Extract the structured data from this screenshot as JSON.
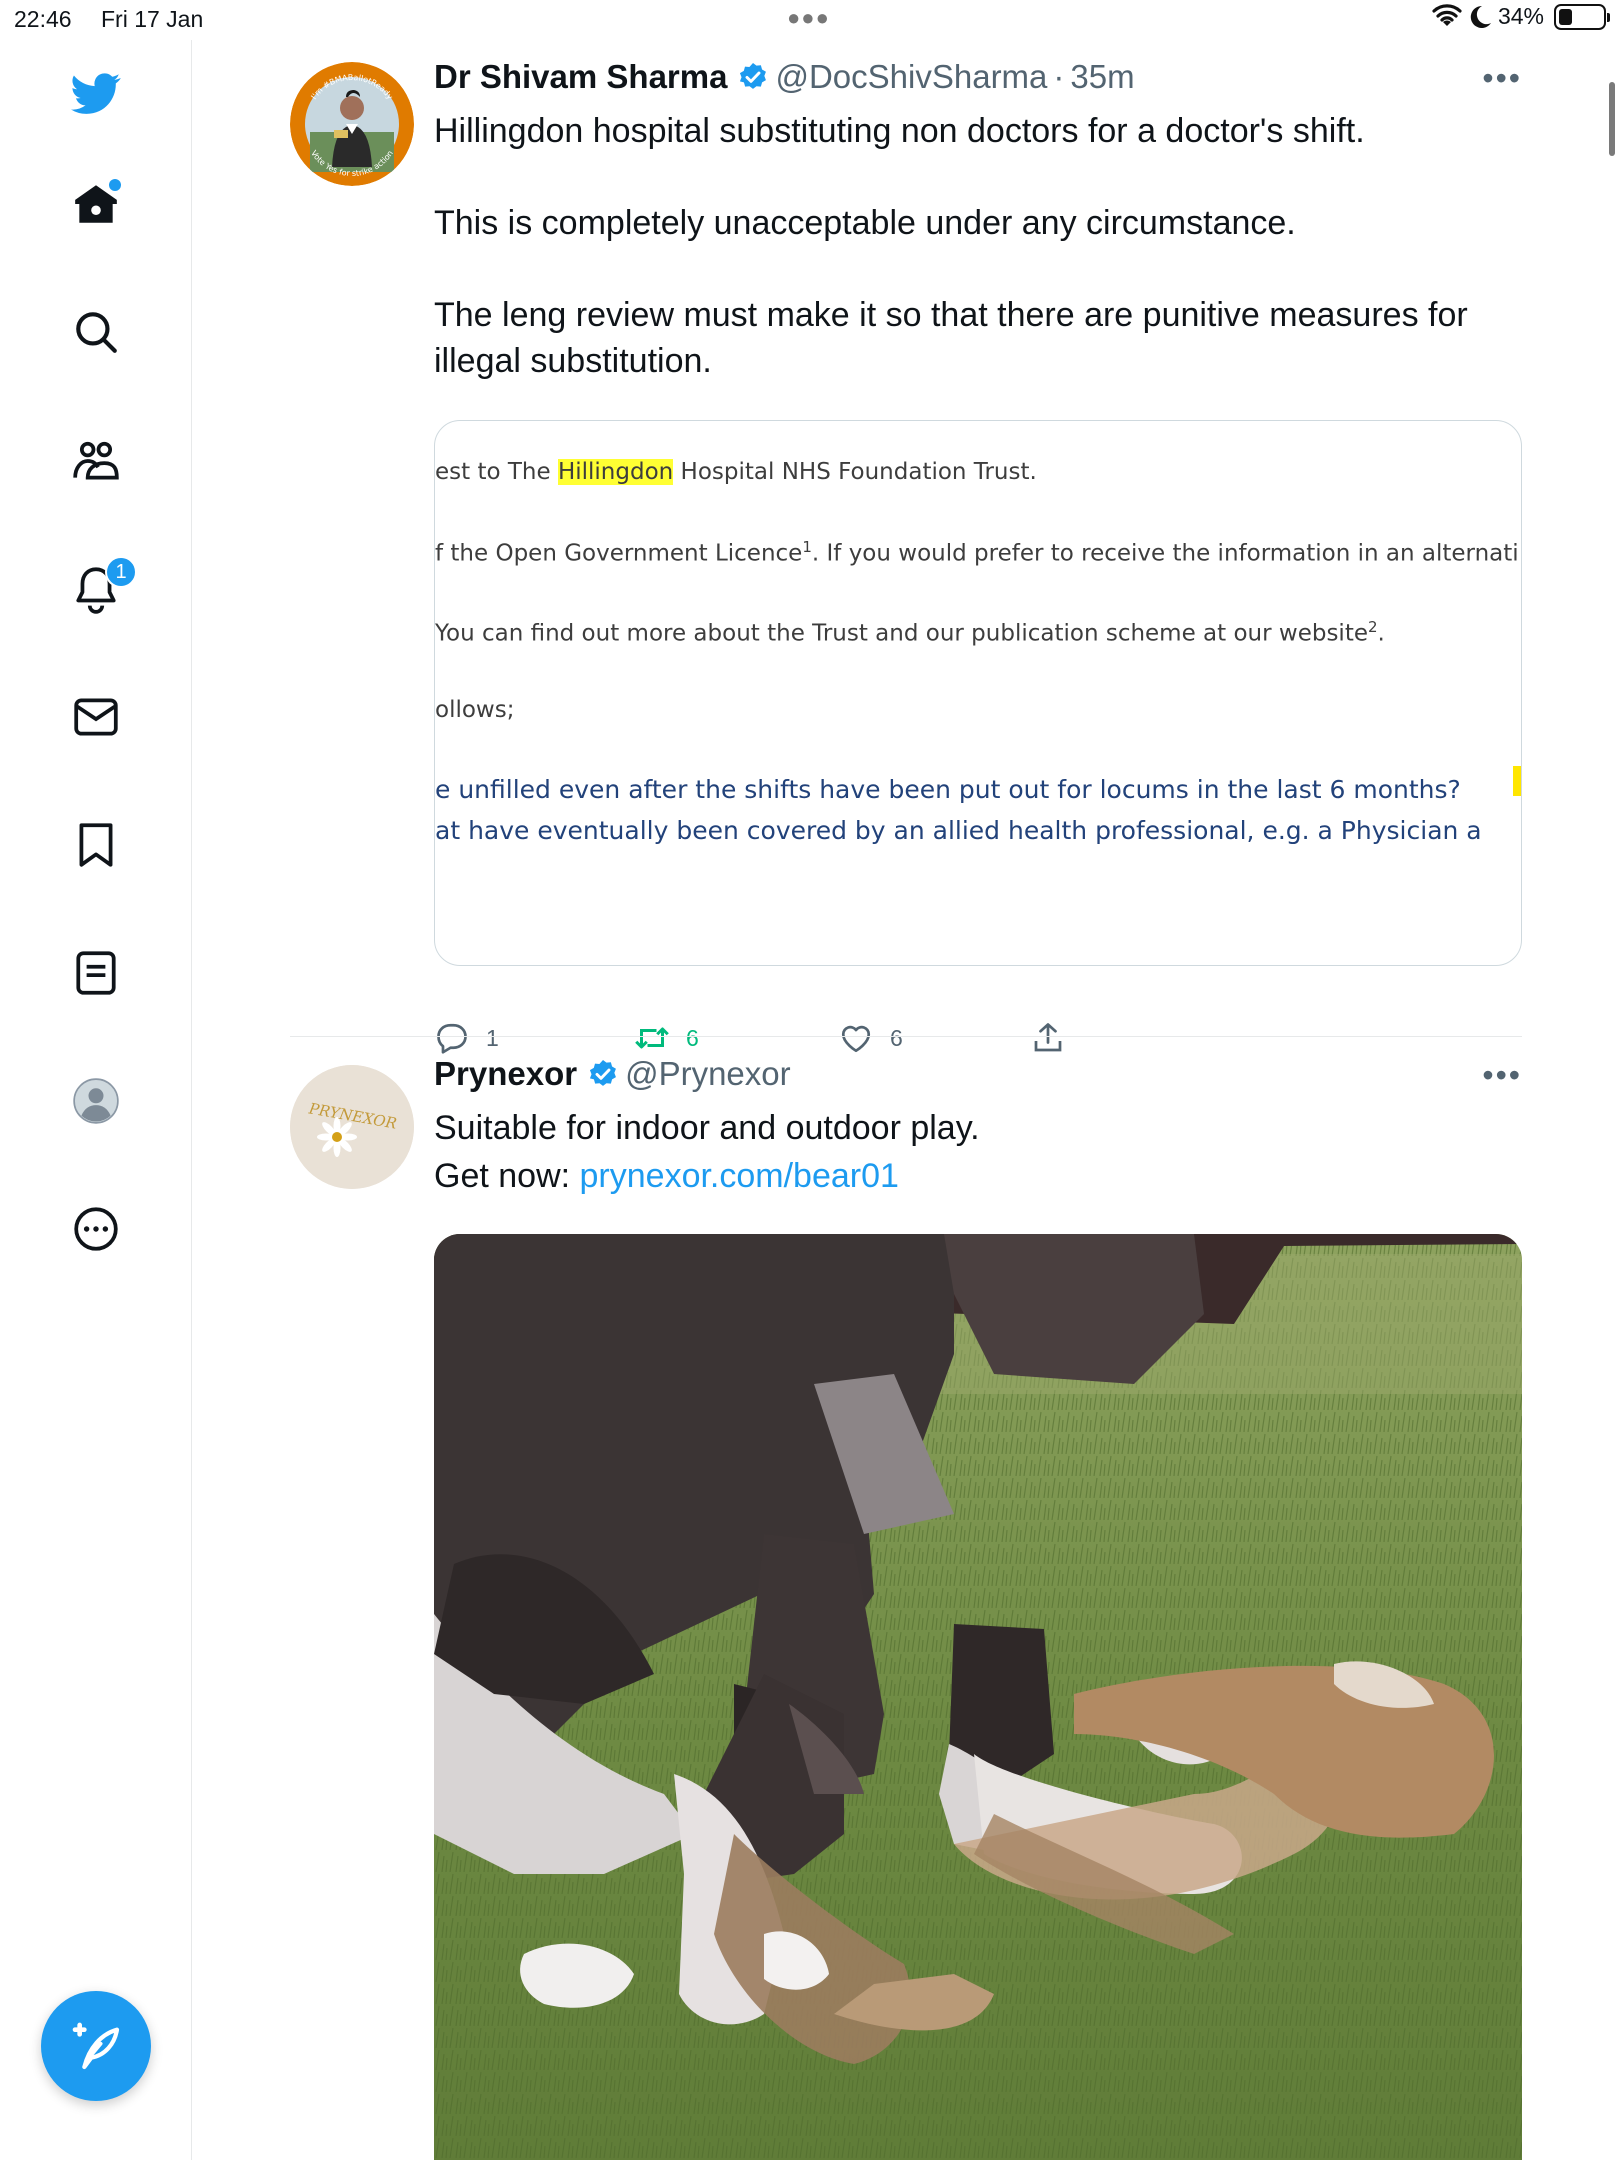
{
  "status_bar": {
    "time": "22:46",
    "date": "Fri 17 Jan",
    "battery": "34%"
  },
  "sidebar": {
    "items": [
      {
        "icon": "twitter-logo-icon"
      },
      {
        "icon": "home-icon"
      },
      {
        "icon": "search-icon"
      },
      {
        "icon": "communities-icon"
      },
      {
        "icon": "notifications-icon",
        "badge": "1"
      },
      {
        "icon": "messages-icon"
      },
      {
        "icon": "bookmarks-icon"
      },
      {
        "icon": "lists-icon"
      },
      {
        "icon": "profile-icon"
      },
      {
        "icon": "more-icon"
      }
    ],
    "compose": {
      "icon": "compose-icon"
    }
  },
  "tweets": [
    {
      "name": "Dr Shivam Sharma",
      "handle": "@DocShivSharma",
      "sep": "·",
      "time": "35m",
      "avatar_ring": "#e07b00",
      "avatar_text_top": "I'm #BMABallotReady",
      "avatar_text_bottom": "Vote Yes for strike action",
      "text": "Hillingdon hospital substituting non doctors for a doctor's shift.\n\nThis is completely unacceptable under any circumstance.\n\nThe leng review must make it so that there are punitive measures for illegal substitution.",
      "document": {
        "line1_pre": "est to The ",
        "line1_hl": "Hillingdon",
        "line1_post": " Hospital NHS Foundation Trust.",
        "line2": "f the Open Government Licence",
        "line2_sup": "1",
        "line2_post": ". If you would prefer to receive the information in an alternati",
        "line3": " You can find out more about the Trust and our publication scheme at our website",
        "line3_sup": "2",
        "line3_post": ".",
        "line4": "ollows;",
        "q1": "e unfilled even after the shifts have been put out for locums in the last 6 months?",
        "q2": "at have eventually been covered by an allied health professional, e.g. a Physician a"
      },
      "actions": {
        "replies": "1",
        "retweets": "6",
        "likes": "6"
      }
    },
    {
      "name": "Prynexor",
      "handle": "@Prynexor",
      "avatar_text": "PRYNEXOR",
      "text_line1": "Suitable for indoor and outdoor play.",
      "text_line2_pre": "Get now: ",
      "link": "prynexor.com/bear01"
    }
  ],
  "colors": {
    "accent": "#1d9bf0",
    "retweet": "#00ba7c",
    "muted": "#536471"
  }
}
